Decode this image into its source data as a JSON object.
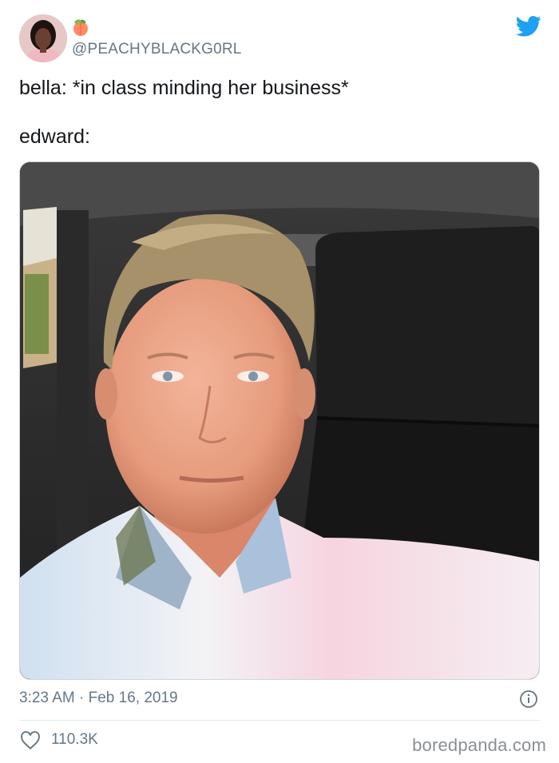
{
  "author": {
    "handle": "@PEACHYBLACKG0RL",
    "avatar_icon": "profile-avatar",
    "badge_icon": "peach-emoji-icon"
  },
  "tweet": {
    "line1": "bella: *in class minding her business*",
    "line2": "edward:"
  },
  "meta": {
    "time": "3:23 AM",
    "separator": "·",
    "date": "Feb 16, 2019"
  },
  "engagement": {
    "likes": "110.3K"
  },
  "watermark": "boredpanda.com",
  "colors": {
    "twitter_blue": "#1da1f2",
    "muted_text": "#657786",
    "text": "#14171a",
    "divider": "#e1e8ed"
  }
}
